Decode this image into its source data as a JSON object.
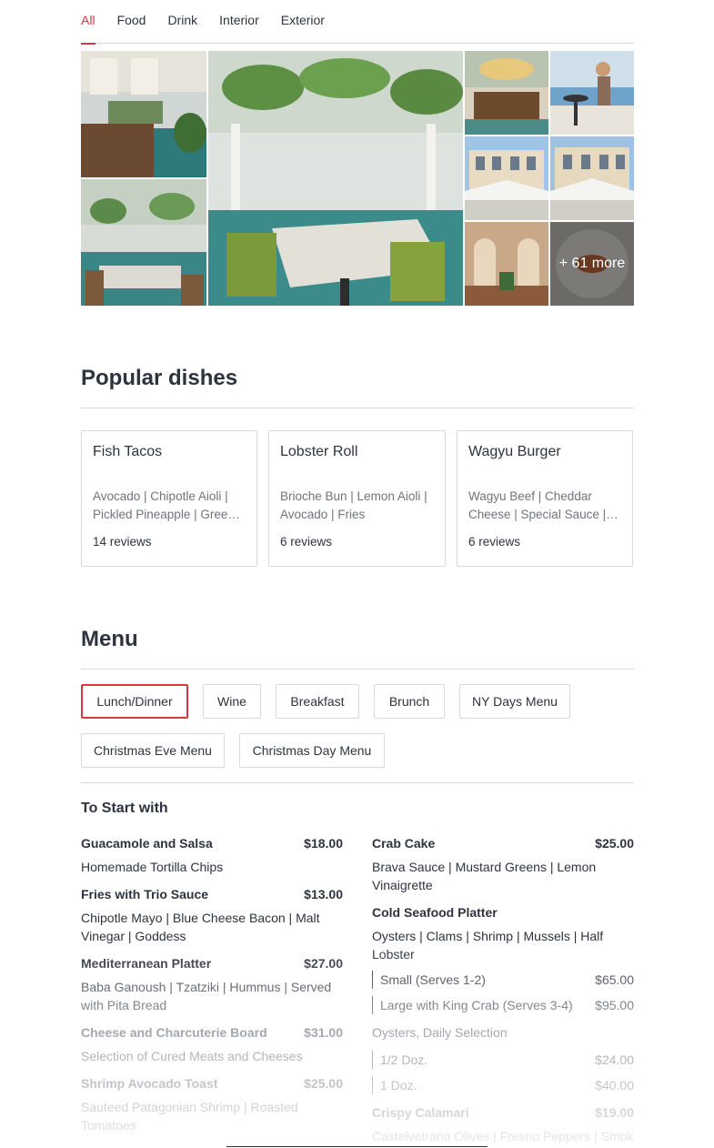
{
  "photo_tabs": [
    "All",
    "Food",
    "Drink",
    "Interior",
    "Exterior"
  ],
  "photos": {
    "more_label": "+ 61 more"
  },
  "popular_dishes": {
    "title": "Popular dishes",
    "items": [
      {
        "name": "Fish Tacos",
        "desc": "Avocado | Chipotle Aioli | Pickled Pineapple | Green Cabbage",
        "reviews": "14 reviews"
      },
      {
        "name": "Lobster Roll",
        "desc": "Brioche Bun | Lemon Aioli | Avocado | Fries",
        "reviews": "6 reviews"
      },
      {
        "name": "Wagyu Burger",
        "desc": "Wagyu Beef | Cheddar Cheese | Special Sauce | Brioche Bun",
        "reviews": "6 reviews"
      }
    ]
  },
  "menu": {
    "title": "Menu",
    "tabs": [
      "Lunch/Dinner",
      "Wine",
      "Breakfast",
      "Brunch",
      "NY Days Menu",
      "Christmas Eve Menu",
      "Christmas Day Menu"
    ],
    "active_tab": "Lunch/Dinner",
    "section_title": "To Start with",
    "left": [
      {
        "name": "Guacamole and Salsa",
        "price": "$18.00",
        "desc": "Homemade Tortilla Chips"
      },
      {
        "name": "Fries with Trio Sauce",
        "price": "$13.00",
        "desc": "Chipotle Mayo | Blue Cheese Bacon | Malt Vinegar | Goddess"
      },
      {
        "name": "Mediterranean Platter",
        "price": "$27.00",
        "desc": "Baba Ganoush | Tzatziki | Hummus | Served with Pita Bread"
      },
      {
        "name": "Cheese and Charcuterie Board",
        "price": "$31.00",
        "desc": "Selection of Cured Meats and Cheeses"
      },
      {
        "name": "Shrimp Avocado Toast",
        "price": "$25.00",
        "desc": "Sauteed Patagonian Shrimp | Roasted Tomatoes"
      }
    ],
    "right": {
      "crab": {
        "name": "Crab Cake",
        "price": "$25.00",
        "desc": "Brava Sauce | Mustard Greens | Lemon Vinaigrette"
      },
      "seafood": {
        "name": "Cold Seafood Platter",
        "desc": "Oysters | Clams | Shrimp | Mussels | Half Lobster",
        "variants": [
          {
            "label": "Small (Serves 1-2)",
            "price": "$65.00"
          },
          {
            "label": "Large with King Crab (Serves 3-4)",
            "price": "$95.00"
          }
        ]
      },
      "oysters": {
        "name": "Oysters, Daily Selection",
        "variants": [
          {
            "label": "1/2 Doz.",
            "price": "$24.00"
          },
          {
            "label": "1 Doz.",
            "price": "$40.00"
          }
        ]
      },
      "calamari": {
        "name": "Crispy Calamari",
        "price": "$19.00",
        "desc": "Castelvetrano Olives | Fresno Peppers | Smokey"
      }
    }
  },
  "colors": {
    "accent": "#da3743",
    "text": "#2d333f",
    "muted": "#6f737b",
    "border": "#d8d9db"
  }
}
